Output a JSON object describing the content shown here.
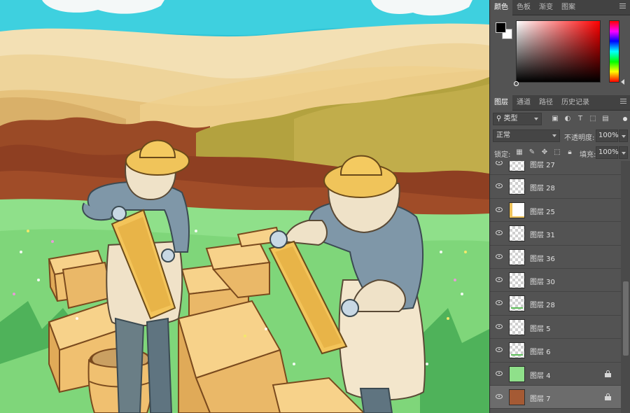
{
  "color_panel": {
    "tabs": [
      {
        "label": "颜色",
        "active": true
      },
      {
        "label": "色板",
        "active": false
      },
      {
        "label": "渐变",
        "active": false
      },
      {
        "label": "图案",
        "active": false
      }
    ],
    "foreground_color": "#000000",
    "background_color": "#ffffff",
    "hue_color": "#ff0000"
  },
  "layers_panel": {
    "tabs": [
      {
        "label": "图层",
        "active": true
      },
      {
        "label": "通道",
        "active": false
      },
      {
        "label": "路径",
        "active": false
      },
      {
        "label": "历史记录",
        "active": false
      }
    ],
    "filter_type": "类型",
    "blend_mode": "正常",
    "opacity_label": "不透明度:",
    "opacity_value": "100%",
    "lock_label": "锁定:",
    "fill_label": "填充:",
    "fill_value": "100%",
    "layers": [
      {
        "name": "图层 27",
        "locked": false,
        "selected": false,
        "thumb": "empty"
      },
      {
        "name": "图层 28",
        "locked": false,
        "selected": false,
        "thumb": "empty"
      },
      {
        "name": "图层 25",
        "locked": false,
        "selected": false,
        "thumb": "yellow"
      },
      {
        "name": "图层 31",
        "locked": false,
        "selected": false,
        "thumb": "empty"
      },
      {
        "name": "图层 36",
        "locked": false,
        "selected": false,
        "thumb": "empty"
      },
      {
        "name": "图层 30",
        "locked": false,
        "selected": false,
        "thumb": "empty"
      },
      {
        "name": "图层 28",
        "locked": false,
        "selected": false,
        "thumb": "green-lines"
      },
      {
        "name": "图层 5",
        "locked": false,
        "selected": false,
        "thumb": "empty"
      },
      {
        "name": "图层 6",
        "locked": false,
        "selected": false,
        "thumb": "green-lines"
      },
      {
        "name": "图层 4",
        "locked": true,
        "selected": false,
        "thumb": "green"
      },
      {
        "name": "图层 7",
        "locked": true,
        "selected": true,
        "thumb": "brown"
      }
    ]
  },
  "icons": {
    "search": "search-icon",
    "image_filter": "image-filter-icon",
    "adjustment_filter": "adjustment-filter-icon",
    "text_filter": "text-filter-icon",
    "shape_filter": "shape-filter-icon",
    "smart_filter": "smart-object-filter-icon",
    "lock_transparent": "lock-transparent-pixels-icon",
    "lock_image": "lock-image-pixels-icon",
    "lock_position": "lock-position-icon",
    "lock_artboard": "lock-artboard-icon",
    "lock_all": "lock-all-icon",
    "visibility": "eye-icon",
    "layer_lock": "lock-icon"
  },
  "colors": {
    "panel_bg": "#535353",
    "tab_bg": "#424242",
    "selected_layer": "#6c6c6c"
  }
}
